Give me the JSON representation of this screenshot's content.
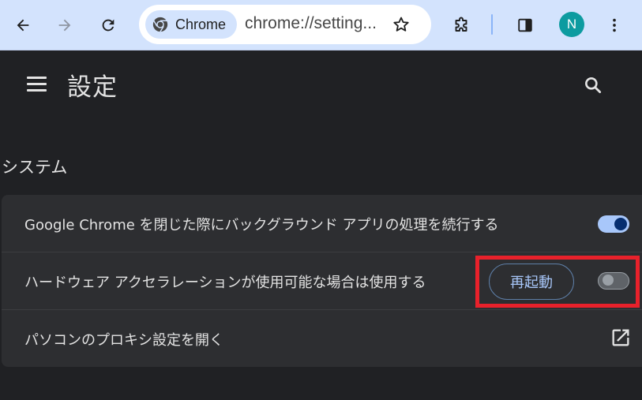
{
  "toolbar": {
    "chip_label": "Chrome",
    "url": "chrome://setting...",
    "avatar_letter": "N",
    "icons": [
      "back-arrow-icon",
      "forward-arrow-icon",
      "reload-icon",
      "chrome-logo-icon",
      "star-icon",
      "extensions-icon",
      "side-panel-icon"
    ]
  },
  "header": {
    "title": "設定"
  },
  "section": {
    "title": "システム"
  },
  "rows": [
    {
      "label": "Google Chrome を閉じた際にバックグラウンド アプリの処理を続行する",
      "toggle": "on"
    },
    {
      "label": "ハードウェア アクセラレーションが使用可能な場合は使用する",
      "toggle": "off",
      "button_label": "再起動"
    },
    {
      "label": "パソコンのプロキシ設定を開く",
      "icon": "open-in-new-icon"
    }
  ],
  "colors": {
    "toolbar_bg": "#d3e3fd",
    "page_bg": "#202124",
    "card_bg": "#2d2e31",
    "accent": "#a8c7fa",
    "highlight": "#e8212b"
  }
}
